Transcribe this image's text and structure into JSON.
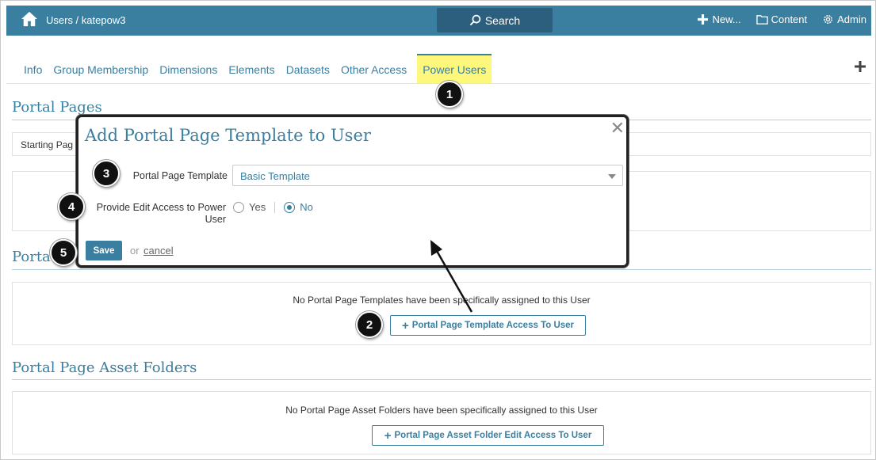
{
  "topbar": {
    "breadcrumb": "Users / katepow3",
    "search_label": "Search",
    "new_label": "New...",
    "content_label": "Content",
    "admin_label": "Admin"
  },
  "tabs": [
    {
      "label": "Info"
    },
    {
      "label": "Group Membership"
    },
    {
      "label": "Dimensions"
    },
    {
      "label": "Elements"
    },
    {
      "label": "Datasets"
    },
    {
      "label": "Other Access"
    },
    {
      "label": "Power Users",
      "active": true
    }
  ],
  "sections": {
    "portal_pages": {
      "title": "Portal Pages",
      "starting_page_label": "Starting Pag"
    },
    "portal_templates": {
      "title": "Porta",
      "empty_message": "No Portal Page Templates have been specifically assigned to this User",
      "add_button": "Portal Page Template Access To User"
    },
    "asset_folders": {
      "title": "Portal Page Asset Folders",
      "empty_message": "No Portal Page Asset Folders have been specifically assigned to this User",
      "add_button": "Portal Page Asset Folder Edit Access To User"
    }
  },
  "modal": {
    "title": "Add Portal Page Template to User",
    "close_glyph": "✕",
    "template_label": "Portal Page Template",
    "template_value": "Basic Template",
    "edit_access_label_line1": "Provide Edit Access to Power",
    "edit_access_label_line2": "User",
    "option_yes": "Yes",
    "option_no": "No",
    "selected_option": "No",
    "save_label": "Save",
    "or_text": "or",
    "cancel_label": "cancel"
  },
  "callouts": [
    "1",
    "2",
    "3",
    "4",
    "5"
  ],
  "colors": {
    "brand": "#3a7fa0",
    "highlight": "#fdf77c",
    "topbar_dark": "#2c5f7d"
  },
  "icons": {
    "home": "home-icon",
    "search": "search-icon",
    "new": "plus-icon",
    "content": "folder-icon",
    "admin": "gear-icon",
    "add": "plus-icon",
    "close": "close-icon",
    "dropdown": "chevron-down-icon"
  }
}
